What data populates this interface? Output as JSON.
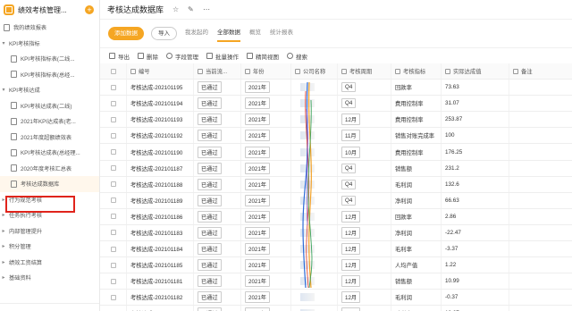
{
  "app": {
    "title": "绩效考核管理...",
    "plus_label": "+"
  },
  "sidebar": {
    "items": [
      {
        "label": "我的绩效报表",
        "level": 0,
        "arrow": "",
        "icon": true
      },
      {
        "label": "KPI考核指标",
        "level": 0,
        "arrow": "▾",
        "icon": false
      },
      {
        "label": "KPI考核指标表(二线...",
        "level": 1,
        "arrow": "",
        "icon": true
      },
      {
        "label": "KPI考核指标表(总经...",
        "level": 1,
        "arrow": "",
        "icon": true
      },
      {
        "label": "KPI考核达成",
        "level": 0,
        "arrow": "▾",
        "icon": false
      },
      {
        "label": "KPI考核达成表(二线)",
        "level": 1,
        "arrow": "",
        "icon": true
      },
      {
        "label": "2021年KPI达成表(老...",
        "level": 1,
        "arrow": "",
        "icon": true
      },
      {
        "label": "2021年度超额绩效表",
        "level": 1,
        "arrow": "",
        "icon": true
      },
      {
        "label": "KPI考核达成表(总经理...",
        "level": 1,
        "arrow": "",
        "icon": true
      },
      {
        "label": "2020年度考核汇总表",
        "level": 1,
        "arrow": "",
        "icon": true
      },
      {
        "label": "考核达成数据库",
        "level": 1,
        "arrow": "",
        "icon": true,
        "active": true
      },
      {
        "label": "行为规范考核",
        "level": 0,
        "arrow": "▸",
        "icon": false
      },
      {
        "label": "任务执行考核",
        "level": 0,
        "arrow": "▸",
        "icon": false
      },
      {
        "label": "内部管理提升",
        "level": 0,
        "arrow": "▸",
        "icon": false
      },
      {
        "label": "积分管理",
        "level": 0,
        "arrow": "▸",
        "icon": false
      },
      {
        "label": "绩效工资结算",
        "level": 0,
        "arrow": "▸",
        "icon": false
      },
      {
        "label": "基础资料",
        "level": 0,
        "arrow": "▸",
        "icon": false
      }
    ]
  },
  "header": {
    "title": "考核达成数据库",
    "icons": [
      "star-icon",
      "edit-icon",
      "more-icon"
    ]
  },
  "tabs": {
    "add_label": "添加数据",
    "import_label": "导入",
    "items": [
      "我发起的",
      "全部数据",
      "概览",
      "统计报表"
    ],
    "active": "全部数据"
  },
  "toolbar": {
    "export": "导出",
    "delete": "删除",
    "fields": "字段管理",
    "batch": "批量操作",
    "view": "精简视图",
    "search": "搜索"
  },
  "table": {
    "headers": [
      "编号",
      "当前流...",
      "年份",
      "公司名称",
      "考核周期",
      "考核指标",
      "实际达成值",
      "备注"
    ],
    "rows": [
      [
        "考核达成-202101195",
        "已通过",
        "2021年",
        "",
        "Q4",
        "回款率",
        "73.63",
        ""
      ],
      [
        "考核达成-202101194",
        "已通过",
        "2021年",
        "",
        "Q4",
        "费用控制率",
        "31.07",
        ""
      ],
      [
        "考核达成-202101193",
        "已通过",
        "2021年",
        "",
        "12月",
        "费用控制率",
        "253.87",
        ""
      ],
      [
        "考核达成-202101192",
        "已通过",
        "2021年",
        "",
        "11月",
        "销售对账完成率",
        "100",
        ""
      ],
      [
        "考核达成-202101190",
        "已通过",
        "2021年",
        "",
        "10月",
        "费用控制率",
        "176.25",
        ""
      ],
      [
        "考核达成-202101187",
        "已通过",
        "2021年",
        "",
        "Q4",
        "销售额",
        "231.2",
        ""
      ],
      [
        "考核达成-202101188",
        "已通过",
        "2021年",
        "",
        "Q4",
        "毛利润",
        "132.6",
        ""
      ],
      [
        "考核达成-202101189",
        "已通过",
        "2021年",
        "",
        "Q4",
        "净利润",
        "66.63",
        ""
      ],
      [
        "考核达成-202101186",
        "已通过",
        "2021年",
        "",
        "12月",
        "回款率",
        "2.86",
        ""
      ],
      [
        "考核达成-202101183",
        "已通过",
        "2021年",
        "",
        "12月",
        "净利润",
        "-22.47",
        ""
      ],
      [
        "考核达成-202101184",
        "已通过",
        "2021年",
        "",
        "12月",
        "毛利率",
        "-3.37",
        ""
      ],
      [
        "考核达成-202101185",
        "已通过",
        "2021年",
        "",
        "12月",
        "人均产值",
        "1.22",
        ""
      ],
      [
        "考核达成-202101181",
        "已通过",
        "2021年",
        "",
        "12月",
        "销售额",
        "10.99",
        ""
      ],
      [
        "考核达成-202101182",
        "已通过",
        "2021年",
        "",
        "12月",
        "毛利润",
        "-0.37",
        ""
      ],
      [
        "考核达成-202101178",
        "已通过",
        "2021年",
        "",
        "11月",
        "毛利率",
        "18.67",
        ""
      ]
    ]
  },
  "colors": {
    "accent": "#f5a623",
    "highlight_border": "#e0241b"
  }
}
